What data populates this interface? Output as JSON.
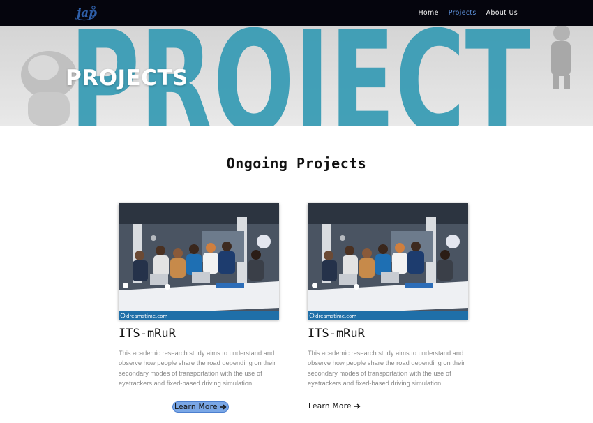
{
  "navbar": {
    "logo_text": "jap",
    "links": [
      {
        "label": "Home",
        "active": false
      },
      {
        "label": "Projects",
        "active": true
      },
      {
        "label": "About Us",
        "active": false
      }
    ],
    "active_color": "#5b8ed6"
  },
  "hero": {
    "title": "PROJECTS",
    "background_word": "PROJECT",
    "accent_color": "#2aa7c4"
  },
  "section": {
    "title": "Ongoing Projects"
  },
  "cards": [
    {
      "title": "ITS-mRuR",
      "description": "This academic research study aims to understand and observe how people share the road depending on their secondary modes of transportation with the use of eyetrackers and fixed-based driving simulation.",
      "image_watermark": "dreamstime.com",
      "button_label": "Learn More",
      "button_highlighted": true
    },
    {
      "title": "ITS-mRuR",
      "description": "This academic research study aims to understand and observe how people share the road depending on their secondary modes of transportation with the use of eyetrackers and fixed-based driving simulation.",
      "image_watermark": "dreamstime.com",
      "button_label": "Learn More",
      "button_highlighted": false
    }
  ]
}
